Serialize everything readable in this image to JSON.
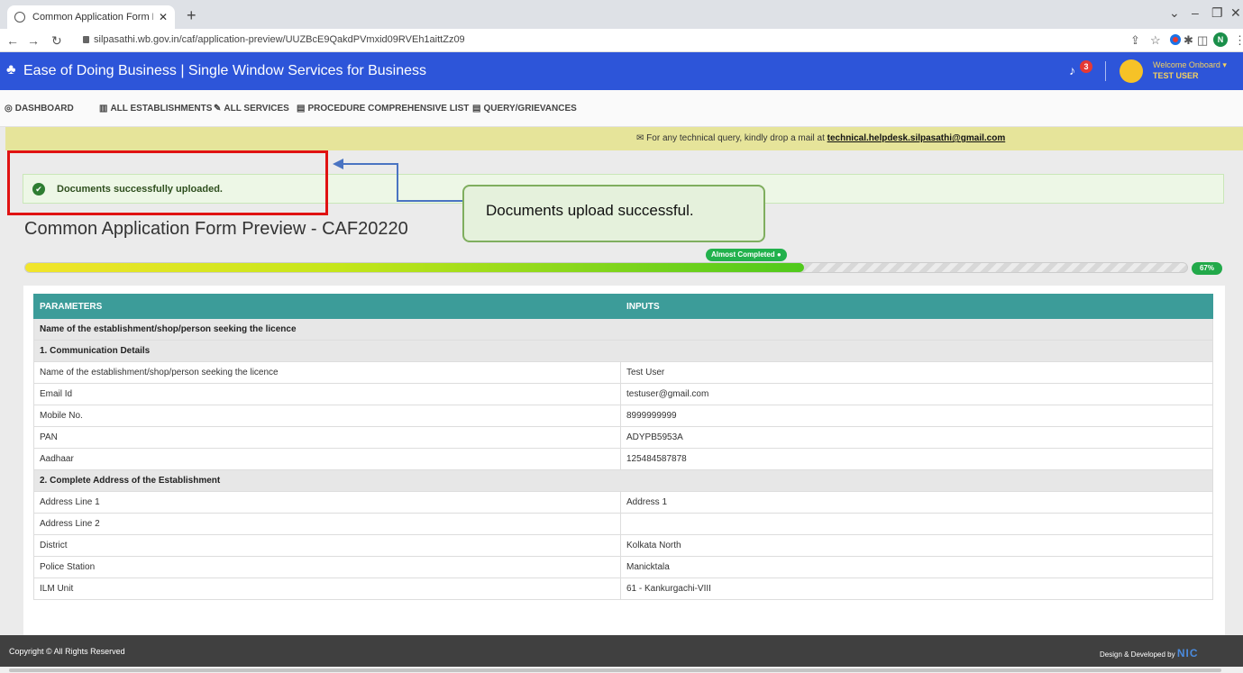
{
  "browser": {
    "tab_title": "Common Application Form Previ",
    "url": "silpasathi.wb.gov.in/caf/application-preview/UUZBcE9QakdPVmxid09RVEh1aittZz09",
    "profile_initial": "N"
  },
  "header": {
    "title": "Ease of Doing Business | Single Window Services for Business",
    "notification_count": "3",
    "welcome": "Welcome Onboard",
    "username": "TEST USER"
  },
  "menu": {
    "dashboard": "DASHBOARD",
    "establishments": "ALL ESTABLISHMENTS",
    "services": "ALL SERVICES",
    "procedures": "PROCEDURE COMPREHENSIVE LIST",
    "query": "QUERY/GRIEVANCES"
  },
  "notice": {
    "prefix": "For any technical query, kindly drop a mail at ",
    "email": "technical.helpdesk.silpasathi@gmail.com"
  },
  "alert": {
    "message": "Documents successfully uploaded."
  },
  "callout": {
    "text": "Documents upload successful."
  },
  "page_title": "Common Application Form Preview - CAF20220",
  "progress": {
    "status": "Almost Completed",
    "percent_label": "67%",
    "percent": 67
  },
  "table": {
    "headers": {
      "parameters": "PARAMETERS",
      "inputs": "INPUTS"
    },
    "rows": {
      "r0": {
        "label": "Name of the establishment/shop/person seeking the licence"
      },
      "r1": {
        "label": "1. Communication Details"
      },
      "r2": {
        "label": "Name of the establishment/shop/person seeking the licence",
        "value": "Test User"
      },
      "r3": {
        "label": "Email Id",
        "value": "testuser@gmail.com"
      },
      "r4": {
        "label": "Mobile No.",
        "value": "8999999999"
      },
      "r5": {
        "label": "PAN",
        "value": "ADYPB5953A"
      },
      "r6": {
        "label": "Aadhaar",
        "value": "125484587878"
      },
      "r7": {
        "label": "2. Complete Address of the Establishment"
      },
      "r8": {
        "label": "Address Line 1",
        "value": "Address 1"
      },
      "r9": {
        "label": "Address Line 2",
        "value": ""
      },
      "r10": {
        "label": "District",
        "value": "Kolkata North"
      },
      "r11": {
        "label": "Police Station",
        "value": "Manicktala"
      },
      "r12": {
        "label": "ILM Unit",
        "value": "61 - Kankurgachi-VIII"
      }
    }
  },
  "footer": {
    "copyright": "Copyright © All Rights Reserved",
    "developed_by": "Design & Developed by",
    "nic": "NIC"
  }
}
